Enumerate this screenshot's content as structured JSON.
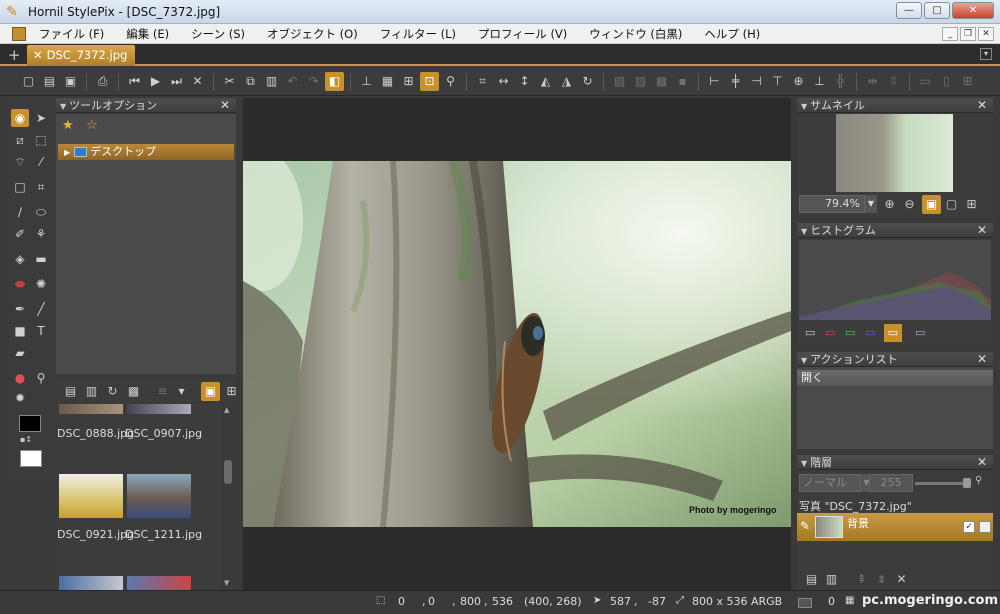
{
  "window": {
    "title": "Hornil StylePix - [DSC_7372.jpg]"
  },
  "window_buttons": {
    "minimize": "—",
    "maximize": "□",
    "close": "✕"
  },
  "menu": [
    "ファイル (F)",
    "編集 (E)",
    "シーン (S)",
    "オブジェクト (O)",
    "フィルター (L)",
    "プロフィール (V)",
    "ウィンドウ (白黒)",
    "ヘルプ (H)"
  ],
  "mdi_buttons": {
    "minimize": "_",
    "restore": "❐",
    "close": "✕"
  },
  "tabs": {
    "add": "+",
    "doc_close": "✕",
    "doc": "DSC_7372.jpg",
    "menu": "▾"
  },
  "tool_options": {
    "title": "ツールオプション",
    "folder": "デスクトップ"
  },
  "thumbnails": {
    "files": [
      "DSC_0888.jpg",
      "DSC_0907.jpg",
      "DSC_0921.jpg",
      "DSC_1211.jpg"
    ]
  },
  "right": {
    "thumbnail_title": "サムネイル",
    "zoom": "79.4%",
    "histogram_title": "ヒストグラム",
    "actions_title": "アクションリスト",
    "action_item": "開く",
    "layers_title": "階層",
    "blend_mode": "ノーマル",
    "opacity": "255",
    "layer_group": "写真 \"DSC_7372.jpg\"",
    "layer_name": "背景"
  },
  "image": {
    "credit": "Photo by mogeringo"
  },
  "status": {
    "x": "0",
    "y": "0",
    "w": "800",
    "h": "536",
    "center": "(400, 268)",
    "cursor_x": "587",
    "cursor_y": "-87",
    "size": "800 x 536 ARGB",
    "zero": "0",
    "watermark": "pc.mogeringo.com"
  },
  "colors": {
    "accent": "#c8912b",
    "panel": "#4a4a4a",
    "bg": "#3a3a3a"
  }
}
